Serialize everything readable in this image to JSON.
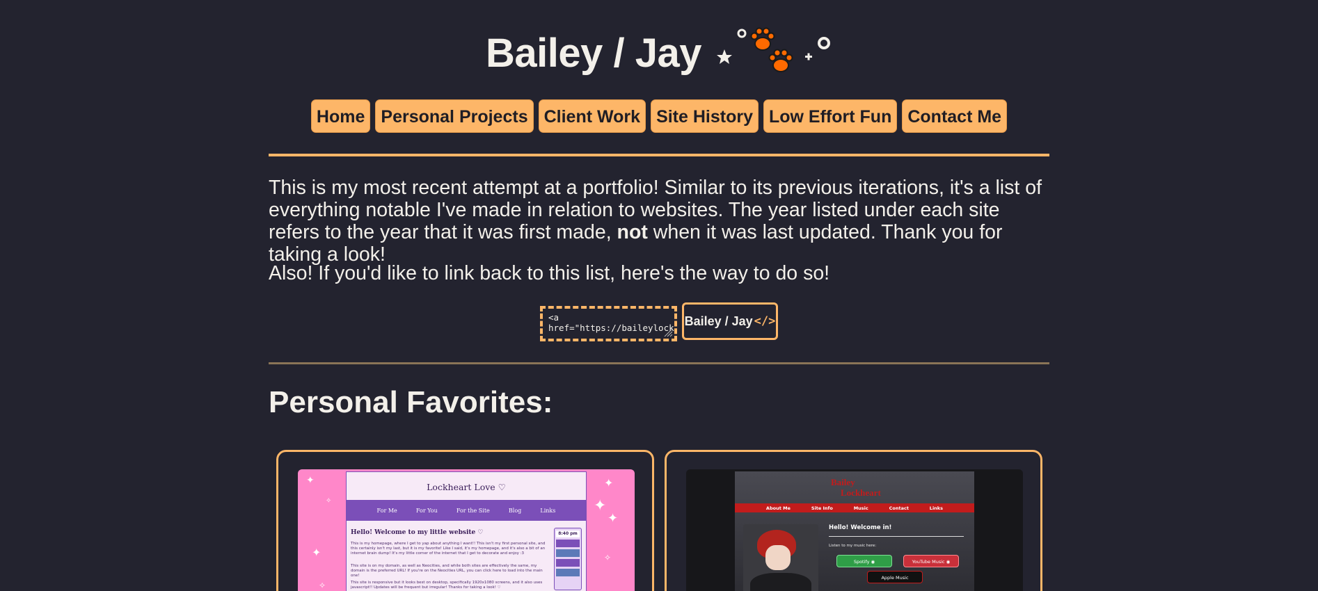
{
  "header": {
    "title": "Bailey / Jay"
  },
  "nav": {
    "items": [
      {
        "label": "Home"
      },
      {
        "label": "Personal Projects"
      },
      {
        "label": "Client Work"
      },
      {
        "label": "Site History"
      },
      {
        "label": "Low Effort Fun"
      },
      {
        "label": "Contact Me"
      }
    ]
  },
  "intro": {
    "text_before": "This is my most recent attempt at a portfolio! Similar to its previous iterations, it's a list of everything notable I've made in relation to websites. The year listed under each site refers to the year that it was first made, ",
    "text_bold": "not",
    "text_after": " when it was last updated. Thank you for taking a look!"
  },
  "linkback": {
    "text": "Also! If you'd like to link back to this list, here's the way to do so!",
    "code": "<a href=\"https://baileylockheart.github.io/\"",
    "badge_label": "Bailey / Jay",
    "badge_tag": "</>"
  },
  "colors": {
    "background": "#23232f",
    "accent": "#fdb668",
    "text": "#f3f0ea"
  },
  "section": {
    "title": "Personal Favorites:"
  },
  "cards": [
    {
      "thumbnail": {
        "site_title": "Lockheart Love ♡",
        "nav": [
          "For Me",
          "For You",
          "For the Site",
          "Blog",
          "Links"
        ],
        "welcome": "Hello! Welcome to my little website ♡",
        "para1": "This is my homepage, where I get to yap about anything I want!! This isn't my first personal site, and this certainly isn't my last, but it is my favorite! Like I said, it's my homepage, and it's also a bit of an internet brain dump! It's my little corner of the internet that I get to decorate and enjoy :3",
        "para2": "This site is on my domain, as well as Neocities, and while both sites are effectively the same, my domain is the preferred URL! If you're on the Neocities URL, you can click here to load into the main one!",
        "para3": "This site is responsive but it looks best on desktop, specifically 1920x1080 screens, and it also uses javascript!! Updates will be frequent but irregular! Thanks for taking a look! ♡",
        "time": "8:40 pm"
      }
    },
    {
      "thumbnail": {
        "logo_line1": "Bailey",
        "logo_line2": "Lockheart",
        "nav": [
          "About Me",
          "Site Info",
          "Music",
          "Contact",
          "Links"
        ],
        "hello": "Hello! Welcome in!",
        "listen": "Listen to my music here:",
        "spotify": "Spotify ◉",
        "youtube": "YouTube Music ◉",
        "apple": "Apple Music "
      }
    }
  ]
}
